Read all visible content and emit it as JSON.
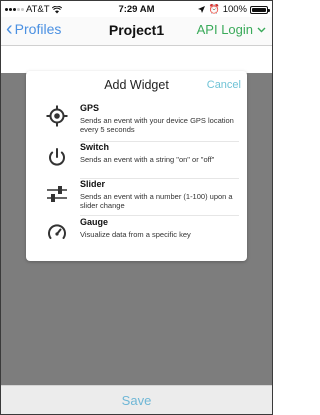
{
  "status_bar": {
    "carrier": "AT&T",
    "time": "7:29 AM",
    "battery": "100%"
  },
  "nav": {
    "back_label": "Profiles",
    "title": "Project1",
    "right_label": "API Login"
  },
  "modal": {
    "title": "Add Widget",
    "cancel": "Cancel",
    "widgets": [
      {
        "name": "GPS",
        "description": "Sends an event with your device GPS location every 5 seconds",
        "icon": "gps-icon"
      },
      {
        "name": "Switch",
        "description": "Sends an event with a string \"on\" or \"off\"",
        "icon": "power-icon"
      },
      {
        "name": "Slider",
        "description": "Sends an event with a number (1-100) upon a slider change",
        "icon": "slider-icon"
      },
      {
        "name": "Gauge",
        "description": "Visualize data from a specific key",
        "icon": "gauge-icon"
      }
    ]
  },
  "footer": {
    "save_label": "Save"
  },
  "colors": {
    "back_blue": "#4a90e2",
    "api_green": "#3aaa5a",
    "cancel_cyan": "#6fc3d6",
    "save_blue": "#6fb7d6",
    "overlay_gray": "#7d7d7d"
  }
}
